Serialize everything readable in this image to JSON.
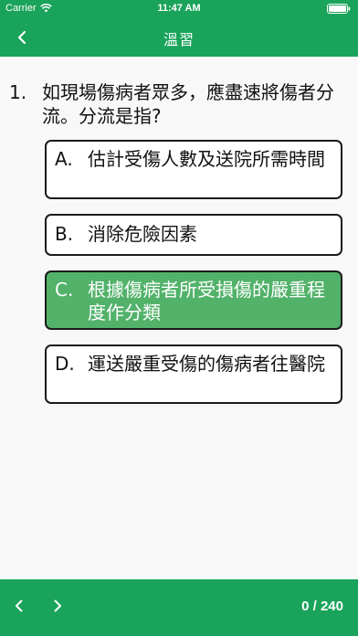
{
  "status_bar": {
    "carrier": "Carrier",
    "time": "11:47 AM",
    "wifi_icon": "wifi-icon",
    "battery_icon": "battery-icon"
  },
  "nav": {
    "title": "溫習",
    "back_icon": "chevron-left-icon"
  },
  "question": {
    "number": "1.",
    "text": "如現場傷病者眾多，應盡速將傷者分流。分流是指?"
  },
  "options": [
    {
      "letter": "A.",
      "text": "估計受傷人數及送院所需時間",
      "selected": false
    },
    {
      "letter": "B.",
      "text": "消除危險因素",
      "selected": false
    },
    {
      "letter": "C.",
      "text": "根據傷病者所受損傷的嚴重程度作分類",
      "selected": true
    },
    {
      "letter": "D.",
      "text": "運送嚴重受傷的傷病者往醫院",
      "selected": false
    }
  ],
  "bottom": {
    "prev_icon": "chevron-left-icon",
    "next_icon": "chevron-right-icon",
    "progress": "0 / 240"
  },
  "colors": {
    "bar_green": "#1aa35a",
    "selected_green": "#52b26a",
    "background": "#f8f8f8",
    "border": "#1b1b1b"
  }
}
